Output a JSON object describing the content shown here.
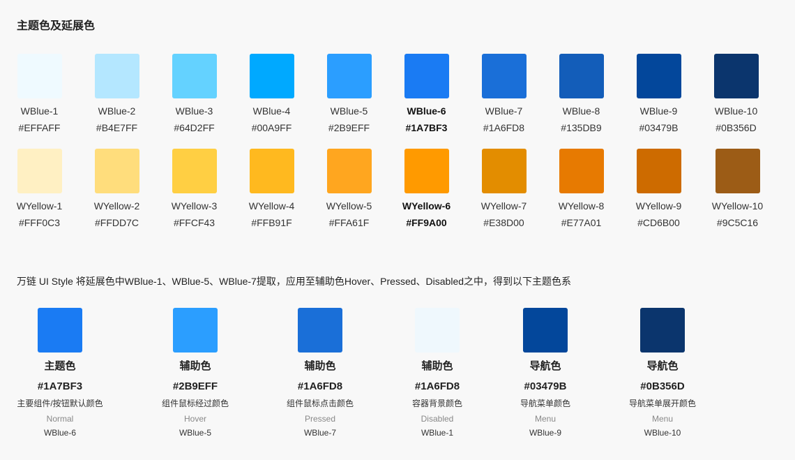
{
  "title": "主题色及延展色",
  "blue_palette": [
    {
      "name": "WBlue-1",
      "hex": "#EFFAFF",
      "color": "#EFFAFF"
    },
    {
      "name": "WBlue-2",
      "hex": "#B4E7FF",
      "color": "#B4E7FF"
    },
    {
      "name": "WBlue-3",
      "hex": "#64D2FF",
      "color": "#64D2FF"
    },
    {
      "name": "WBlue-4",
      "hex": "#00A9FF",
      "color": "#00A9FF"
    },
    {
      "name": "WBlue-5",
      "hex": "#2B9EFF",
      "color": "#2B9EFF"
    },
    {
      "name": "WBlue-6",
      "hex": "#1A7BF3",
      "color": "#1A7BF3",
      "emphasis": true
    },
    {
      "name": "WBlue-7",
      "hex": "#1A6FD8",
      "color": "#1A6FD8"
    },
    {
      "name": "WBlue-8",
      "hex": "#135DB9",
      "color": "#135DB9"
    },
    {
      "name": "WBlue-9",
      "hex": "#03479B",
      "color": "#03479B"
    },
    {
      "name": "WBlue-10",
      "hex": "#0B356D",
      "color": "#0B356D"
    }
  ],
  "yellow_palette": [
    {
      "name": "WYellow-1",
      "hex": "#FFF0C3",
      "color": "#FFF0C3"
    },
    {
      "name": "WYellow-2",
      "hex": "#FFDD7C",
      "color": "#FFDD7C"
    },
    {
      "name": "WYellow-3",
      "hex": "#FFCF43",
      "color": "#FFCF43"
    },
    {
      "name": "WYellow-4",
      "hex": "#FFB91F",
      "color": "#FFB91F"
    },
    {
      "name": "WYellow-5",
      "hex": "#FFA61F",
      "color": "#FFA61F"
    },
    {
      "name": "WYellow-6",
      "hex": "#FF9A00",
      "color": "#FF9A00",
      "emphasis": true
    },
    {
      "name": "WYellow-7",
      "hex": "#E38D00",
      "color": "#E38D00"
    },
    {
      "name": "WYellow-8",
      "hex": "#E77A01",
      "color": "#E77A01"
    },
    {
      "name": "WYellow-9",
      "hex": "#CD6B00",
      "color": "#CD6B00"
    },
    {
      "name": "WYellow-10",
      "hex": "#9C5C16",
      "color": "#9C5C16"
    }
  ],
  "description": "万链 UI Style 将延展色中WBlue-1、WBlue-5、WBlue-7提取，应用至辅助色Hover、Pressed、Disabled之中，得到以下主题色系",
  "theme_colors": [
    {
      "role": "主题色",
      "hex": "#1A7BF3",
      "color": "#1A7BF3",
      "usage": "主要组件/按钮默认颜色",
      "state": "Normal",
      "ref": "WBlue-6"
    },
    {
      "role": "辅助色",
      "hex": "#2B9EFF",
      "color": "#2B9EFF",
      "usage": "组件鼠标经过颜色",
      "state": "Hover",
      "ref": "WBlue-5"
    },
    {
      "role": "辅助色",
      "hex": "#1A6FD8",
      "color": "#1A6FD8",
      "usage": "组件鼠标点击颜色",
      "state": "Pressed",
      "ref": "WBlue-7"
    },
    {
      "role": "辅助色",
      "hex": "#1A6FD8",
      "color": "#EFF8FD",
      "usage": "容器背景颜色",
      "state": "Disabled",
      "ref": "WBlue-1"
    },
    {
      "role": "导航色",
      "hex": "#03479B",
      "color": "#03479B",
      "usage": "导航菜单颜色",
      "state": "Menu",
      "ref": "WBlue-9"
    },
    {
      "role": "导航色",
      "hex": "#0B356D",
      "color": "#0B356D",
      "usage": "导航菜单展开颜色",
      "state": "Menu",
      "ref": "WBlue-10"
    }
  ]
}
